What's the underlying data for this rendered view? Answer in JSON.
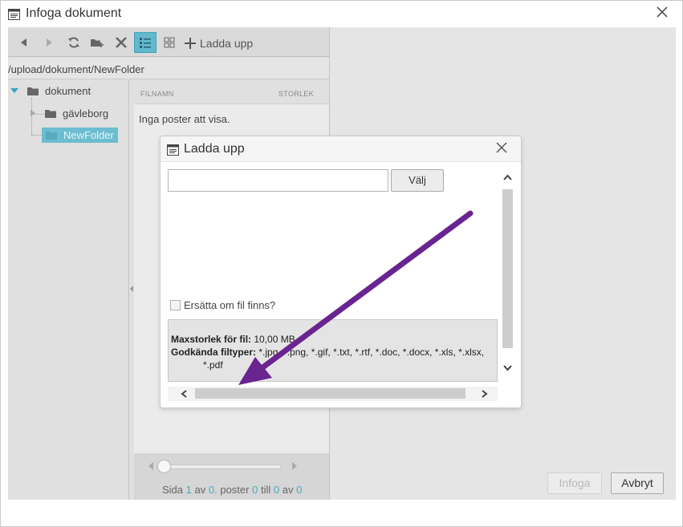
{
  "window": {
    "title": "Infoga dokument"
  },
  "toolbar": {
    "upload_label": "Ladda upp"
  },
  "path": {
    "value": "/upload/dokument/NewFolder"
  },
  "tree": {
    "items": [
      {
        "label": "dokument"
      },
      {
        "label": "gävleborg"
      },
      {
        "label": "NewFolder"
      }
    ]
  },
  "filelist": {
    "col_name": "FILNAMN",
    "col_size": "STORLEK",
    "empty_text": "Inga poster att visa."
  },
  "pager": {
    "page_word": "Sida",
    "page": "1",
    "of_word": "av",
    "pages": "0.",
    "records_word": "poster",
    "from": "0",
    "to_word": "till",
    "to": "0",
    "of_word2": "av",
    "total": "0"
  },
  "buttons": {
    "insert": "Infoga",
    "cancel": "Avbryt"
  },
  "upload_dialog": {
    "title": "Ladda upp",
    "file_value": "",
    "choose_label": "Välj",
    "replace_label": "Ersätta om fil finns?",
    "max_size_label": "Maxstorlek för fil:",
    "max_size_value": "10,00 MB",
    "allowed_label": "Godkända filtyper:",
    "allowed_value": "*.jpg, *.png, *.gif, *.txt, *.rtf, *.doc, *.docx, *.xls, *.xlsx,",
    "allowed_value_cont": "*.pdf"
  },
  "colors": {
    "accent": "#62b8cc",
    "annotation_arrow": "#6a2490"
  },
  "icons": {
    "title": "window-icon",
    "close": "close-icon",
    "back": "arrow-left-icon",
    "forward": "arrow-right-icon",
    "refresh": "refresh-icon",
    "new_folder": "new-folder-icon",
    "delete": "delete-icon",
    "list_view": "list-view-icon",
    "grid_view": "grid-view-icon",
    "upload": "plus-icon",
    "folder": "folder-icon"
  }
}
